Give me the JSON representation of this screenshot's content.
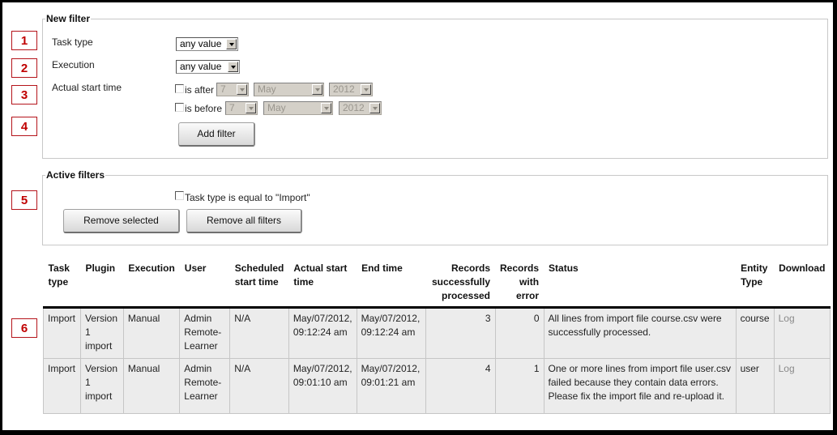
{
  "callouts": [
    "1",
    "2",
    "3",
    "4",
    "5",
    "6"
  ],
  "new_filter": {
    "legend": "New filter",
    "task_type": {
      "label": "Task type",
      "value": "any value"
    },
    "execution": {
      "label": "Execution",
      "value": "any value"
    },
    "actual_start_time": {
      "label": "Actual start time",
      "after": {
        "label": "is after",
        "checked": false,
        "day": "7",
        "month": "May",
        "year": "2012"
      },
      "before": {
        "label": "is before",
        "checked": false,
        "day": "7",
        "month": "May",
        "year": "2012"
      }
    },
    "add_filter_label": "Add filter"
  },
  "active_filters": {
    "legend": "Active filters",
    "filters": [
      {
        "label": "Task type is equal to \"Import\"",
        "checked": false
      }
    ],
    "remove_selected_label": "Remove selected",
    "remove_all_label": "Remove all filters"
  },
  "table": {
    "columns": [
      "Task type",
      "Plugin",
      "Execution",
      "User",
      "Scheduled start time",
      "Actual start time",
      "End time",
      "Records successfully processed",
      "Records with error",
      "Status",
      "Entity Type",
      "Download"
    ],
    "rows": [
      {
        "task_type": "Import",
        "plugin": "Version 1 import",
        "execution": "Manual",
        "user": "Admin Remote-Learner",
        "scheduled_start": "N/A",
        "actual_start": "May/07/2012, 09:12:24 am",
        "end_time": "May/07/2012, 09:12:24 am",
        "records_success": "3",
        "records_error": "0",
        "status": "All lines from import file course.csv were successfully processed.",
        "entity_type": "course",
        "download": "Log"
      },
      {
        "task_type": "Import",
        "plugin": "Version 1 import",
        "execution": "Manual",
        "user": "Admin Remote-Learner",
        "scheduled_start": "N/A",
        "actual_start": "May/07/2012, 09:01:10 am",
        "end_time": "May/07/2012, 09:01:21 am",
        "records_success": "4",
        "records_error": "1",
        "status": "One or more lines from import file user.csv failed because they contain data errors. Please fix the import file and re-upload it.",
        "entity_type": "user",
        "download": "Log"
      }
    ]
  },
  "colors": {
    "callout_red": "#c00000",
    "row_bg": "#ececec",
    "link_gray": "#8a8a8a"
  }
}
